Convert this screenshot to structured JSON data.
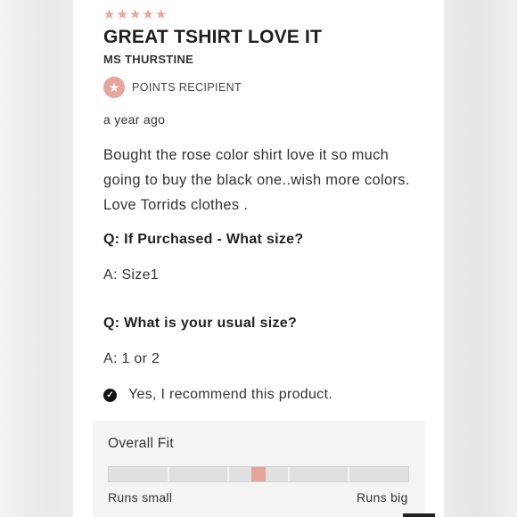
{
  "review": {
    "rating": 5,
    "title": "GREAT TSHIRT LOVE IT",
    "author": "MS THURSTINE",
    "badge": {
      "icon": "star-icon",
      "label": "POINTS RECIPIENT"
    },
    "date": "a year ago",
    "body": "Bought the rose color shirt love it so much going to buy the black one..wish more colors. Love Torrids clothes .",
    "qa": [
      {
        "question": "Q: If Purchased - What size?",
        "answer": "A: Size1"
      },
      {
        "question": "Q: What is your usual size?",
        "answer": "A: 1 or 2"
      }
    ],
    "recommend": {
      "icon": "check-circle-icon",
      "text": "Yes, I recommend this product."
    }
  },
  "fit": {
    "title": "Overall Fit",
    "segments": 5,
    "value": 0.5,
    "min_label": "Runs small",
    "max_label": "Runs big"
  },
  "colors": {
    "accent": "#e6a59c",
    "text": "#333333",
    "panel": "#f4f4f4"
  }
}
